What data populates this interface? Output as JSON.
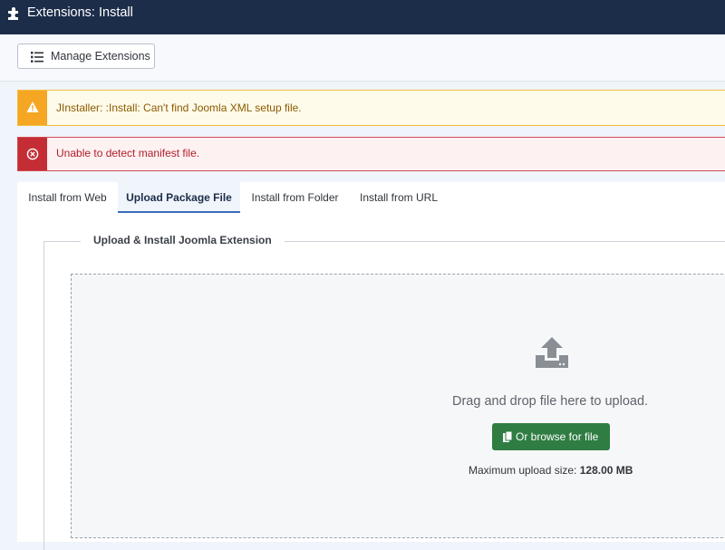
{
  "header": {
    "title": "Extensions: Install",
    "icon": "puzzle-icon"
  },
  "toolbar": {
    "manage_label": "Manage Extensions"
  },
  "alerts": {
    "warning": "JInstaller: :Install: Can't find Joomla XML setup file.",
    "error": "Unable to detect manifest file."
  },
  "tabs": [
    {
      "label": "Install from Web"
    },
    {
      "label": "Upload Package File"
    },
    {
      "label": "Install from Folder"
    },
    {
      "label": "Install from URL"
    }
  ],
  "upload": {
    "legend": "Upload & Install Joomla Extension",
    "drag_text": "Drag and drop file here to upload.",
    "browse_label": "Or browse for file",
    "max_label": "Maximum upload size:",
    "max_value": "128.00 MB"
  },
  "colors": {
    "header_bg": "#1c2d4a",
    "warning": "#f5a623",
    "danger": "#c52d35",
    "browse_button": "#2f7d43",
    "active_tab": "#3b6bb7"
  }
}
